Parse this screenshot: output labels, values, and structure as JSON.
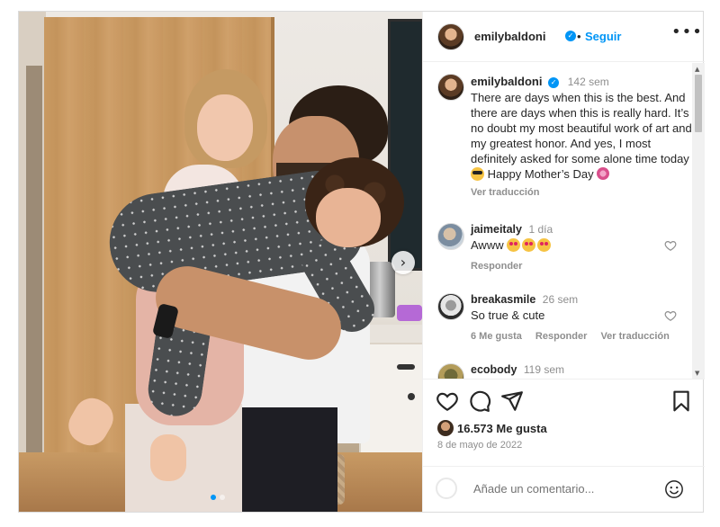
{
  "post": {
    "username": "emilybaldoni",
    "follow_sep": "•",
    "follow_label": "Seguir",
    "more_label": "•••",
    "next_glyph": "›"
  },
  "caption": {
    "username": "emilybaldoni",
    "age": "142 sem",
    "text_part1": "There are days when this is the best. And there are days when this is really hard. It’s no doubt my most beautiful work of art and my greatest honor. And yes, I most definitely asked for some alone time today",
    "text_part2": "Happy Mother’s Day",
    "translate": "Ver traducción"
  },
  "comments": [
    {
      "username": "jaimeitaly",
      "ago": "1 día",
      "text": "Awww",
      "reply": "Responder"
    },
    {
      "username": "breakasmile",
      "ago": "26 sem",
      "text": "So true & cute",
      "likes": "6 Me gusta",
      "reply": "Responder",
      "translate": "Ver traducción"
    },
    {
      "username": "ecobody",
      "ago": "119 sem"
    }
  ],
  "footer": {
    "likes": "16.573 Me gusta",
    "date": "8 de mayo de 2022",
    "comment_placeholder": "Añade un comentario..."
  },
  "colors": {
    "accent": "#0095f6",
    "muted": "#8e8e8e",
    "text": "#262626"
  },
  "icons": [
    "verified-badge-icon",
    "more-icon",
    "next-arrow-icon",
    "heart-icon",
    "comment-icon",
    "share-icon",
    "bookmark-icon",
    "emoji-icon"
  ],
  "carousel": {
    "slides": 2,
    "active": 1
  }
}
